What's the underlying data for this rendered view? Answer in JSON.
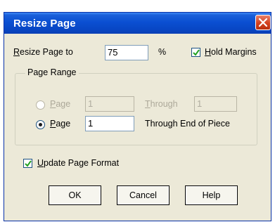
{
  "dialog": {
    "title": "Resize Page"
  },
  "resize": {
    "label_prefix": "R",
    "label_rest": "esize Page to",
    "value": "75",
    "unit": "%"
  },
  "hold_margins": {
    "checked": true,
    "label_prefix": "H",
    "label_rest": "old Margins"
  },
  "page_range": {
    "legend": "Page Range",
    "row1": {
      "label_prefix": "P",
      "label_rest": "age",
      "from_value": "1",
      "through_prefix": "T",
      "through_rest": "hrough",
      "to_value": "1",
      "selected": false
    },
    "row2": {
      "label_prefix": "P",
      "label_rest": "age",
      "from_value": "1",
      "through_text": "Through End of Piece",
      "selected": true
    }
  },
  "update_format": {
    "checked": true,
    "label_prefix": "U",
    "label_rest": "pdate Page Format"
  },
  "buttons": {
    "ok": "OK",
    "cancel": "Cancel",
    "help": "Help"
  },
  "icons": {
    "close": "close-x-icon",
    "check": "checkmark-icon"
  }
}
